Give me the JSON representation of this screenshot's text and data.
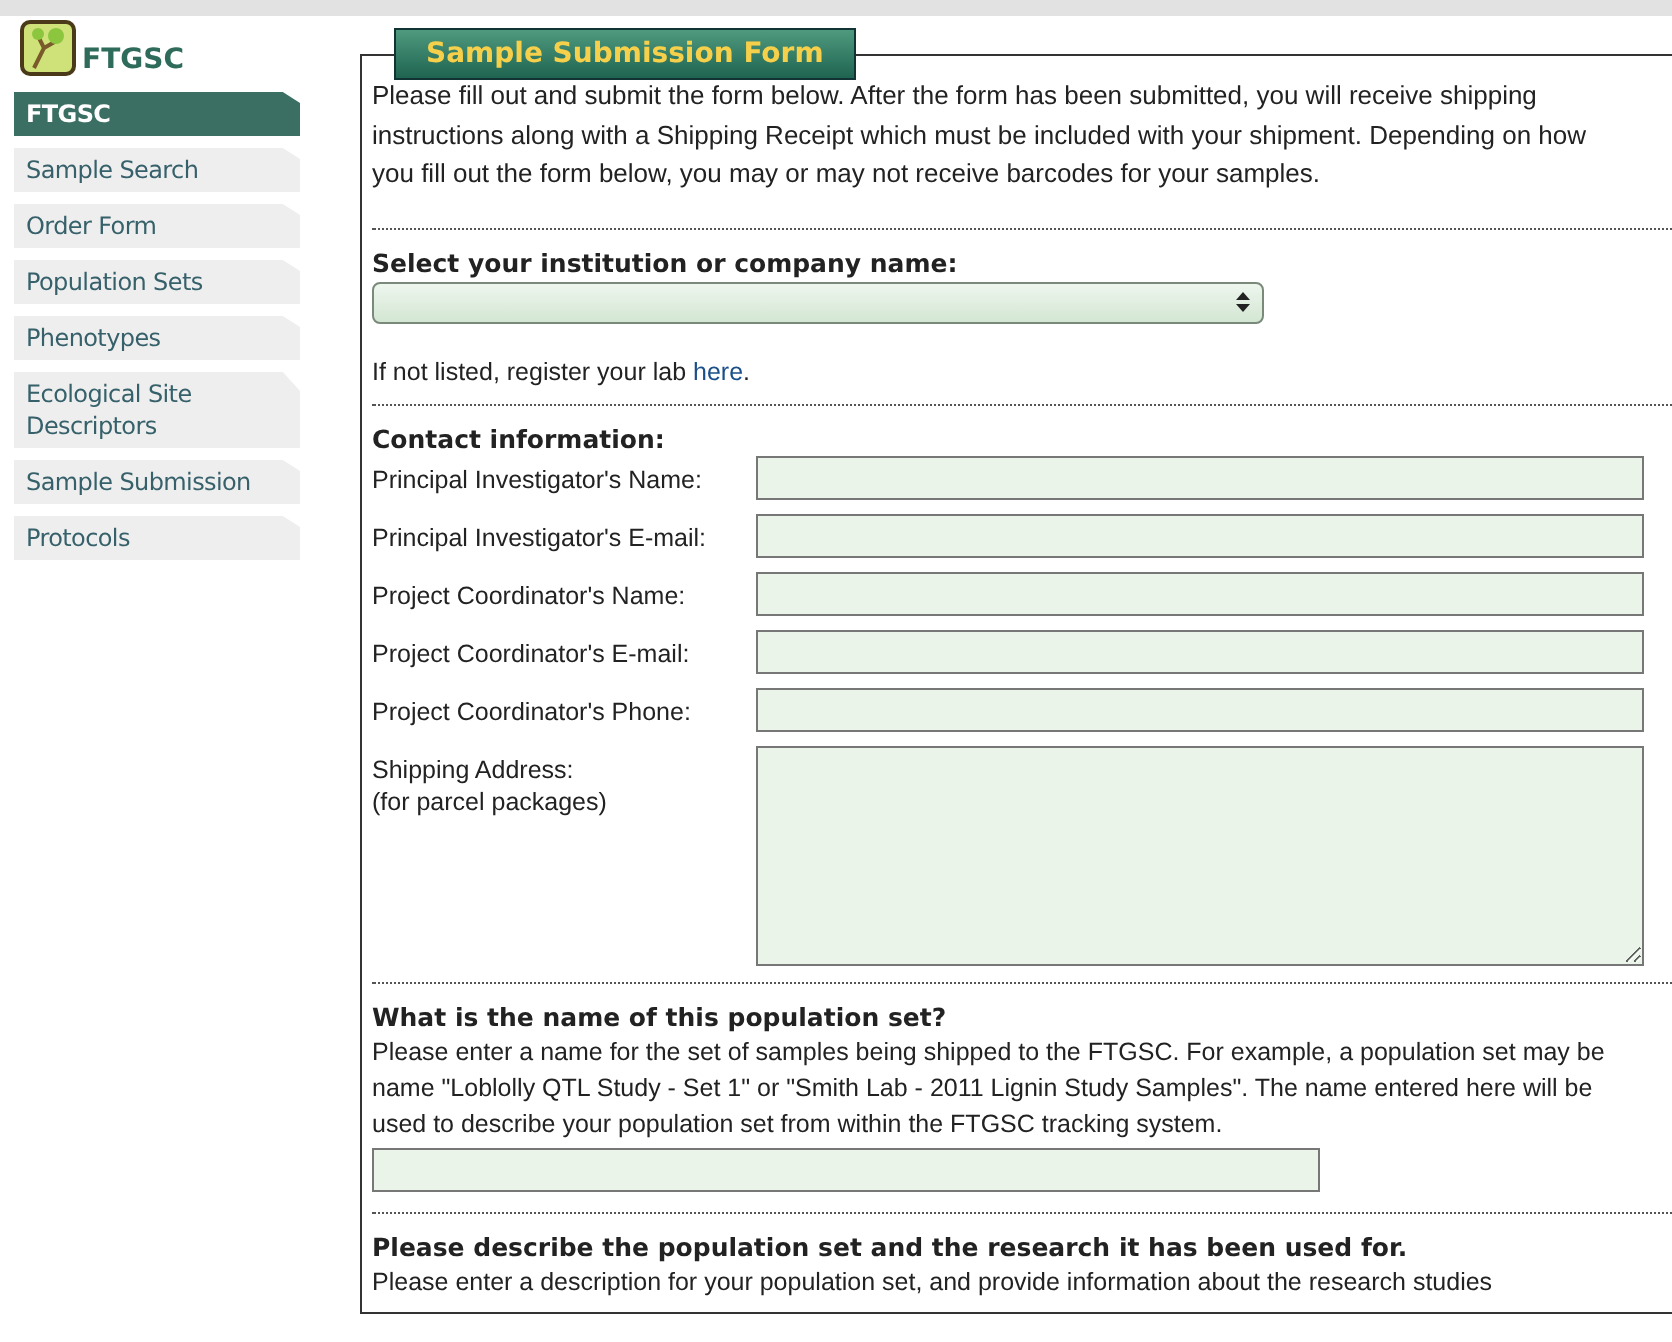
{
  "logo": {
    "title": "FTGSC"
  },
  "nav": [
    {
      "label": "FTGSC",
      "selected": true
    },
    {
      "label": "Sample Search",
      "selected": false
    },
    {
      "label": "Order Form",
      "selected": false
    },
    {
      "label": "Population Sets",
      "selected": false
    },
    {
      "label": "Phenotypes",
      "selected": false
    },
    {
      "label": "Ecological Site Descriptors",
      "selected": false
    },
    {
      "label": "Sample Submission",
      "selected": false
    },
    {
      "label": "Protocols",
      "selected": false
    }
  ],
  "form": {
    "legend": "Sample Submission Form",
    "intro": "Please fill out and submit the form below. After the form has been submitted, you will receive shipping instructions along with a Shipping Receipt which must be included with your shipment. Depending on how you fill out the form below, you may or may not receive barcodes for your samples.",
    "institution": {
      "heading": "Select your institution or company name:",
      "note_before": "If not listed, register your lab",
      "link": "here",
      "note_after": "."
    },
    "contact": {
      "heading": "Contact information:",
      "fields": [
        {
          "label": "Principal Investigator's Name:",
          "kind": "input"
        },
        {
          "label": "Principal Investigator's E-mail:",
          "kind": "input"
        },
        {
          "label": "Project Coordinator's Name:",
          "kind": "input"
        },
        {
          "label": "Project Coordinator's E-mail:",
          "kind": "input"
        },
        {
          "label": "Project Coordinator's Phone:",
          "kind": "input"
        },
        {
          "label": "Shipping Address:",
          "sublabel": "(for parcel packages)",
          "kind": "textarea"
        }
      ]
    },
    "population_name": {
      "heading": "What is the name of this population set?",
      "text": "Please enter a name for the set of samples being shipped to the FTGSC. For example, a population set may be name \"Loblolly QTL Study - Set 1\" or \"Smith Lab - 2011 Lignin Study Samples\". The name entered here will be used to describe your population set from within the FTGSC tracking system."
    },
    "description": {
      "heading": "Please describe the population set and the research it has been used for.",
      "text": "Please enter a description for your population set, and provide information about the research studies"
    }
  }
}
